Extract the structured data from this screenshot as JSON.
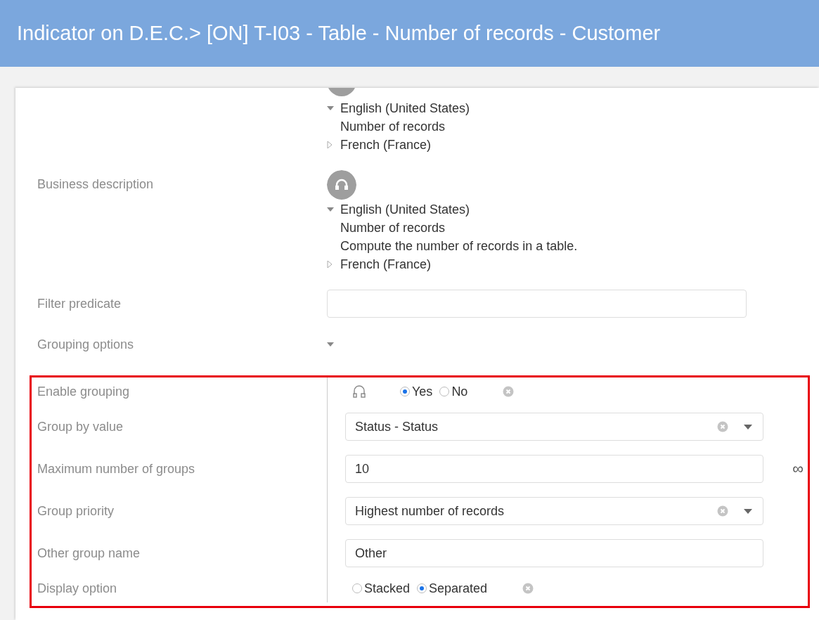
{
  "window": {
    "title": "Indicator on D.E.C.> [ON] T-I03 - Table - Number of records - Customer"
  },
  "business_label": {
    "languages": [
      {
        "name": "English (United States)",
        "expanded": true,
        "lines": [
          "Number of records"
        ]
      },
      {
        "name": "French (France)",
        "expanded": false
      }
    ]
  },
  "business_description": {
    "label": "Business description",
    "languages": [
      {
        "name": "English (United States)",
        "expanded": true,
        "lines": [
          "Number of records",
          "Compute the number of records in a table."
        ]
      },
      {
        "name": "French (France)",
        "expanded": false
      }
    ]
  },
  "filter_predicate": {
    "label": "Filter predicate"
  },
  "grouping_options": {
    "label": "Grouping options",
    "expanded": true,
    "fields": [
      {
        "kind": "radio",
        "label": "Enable grouping",
        "options": [
          {
            "label": "Yes",
            "selected": true
          },
          {
            "label": "No",
            "selected": false
          }
        ]
      },
      {
        "kind": "select",
        "label": "Group by value",
        "value": "Status - Status"
      },
      {
        "kind": "input",
        "label": "Maximum number of groups",
        "value": "10",
        "suffix": "∞"
      },
      {
        "kind": "select",
        "label": "Group priority",
        "value": "Highest number of records"
      },
      {
        "kind": "input",
        "label": "Other group name",
        "value": "Other"
      },
      {
        "kind": "radio",
        "label": "Display option",
        "options": [
          {
            "label": "Stacked",
            "selected": false
          },
          {
            "label": "Separated",
            "selected": true
          }
        ]
      }
    ]
  }
}
